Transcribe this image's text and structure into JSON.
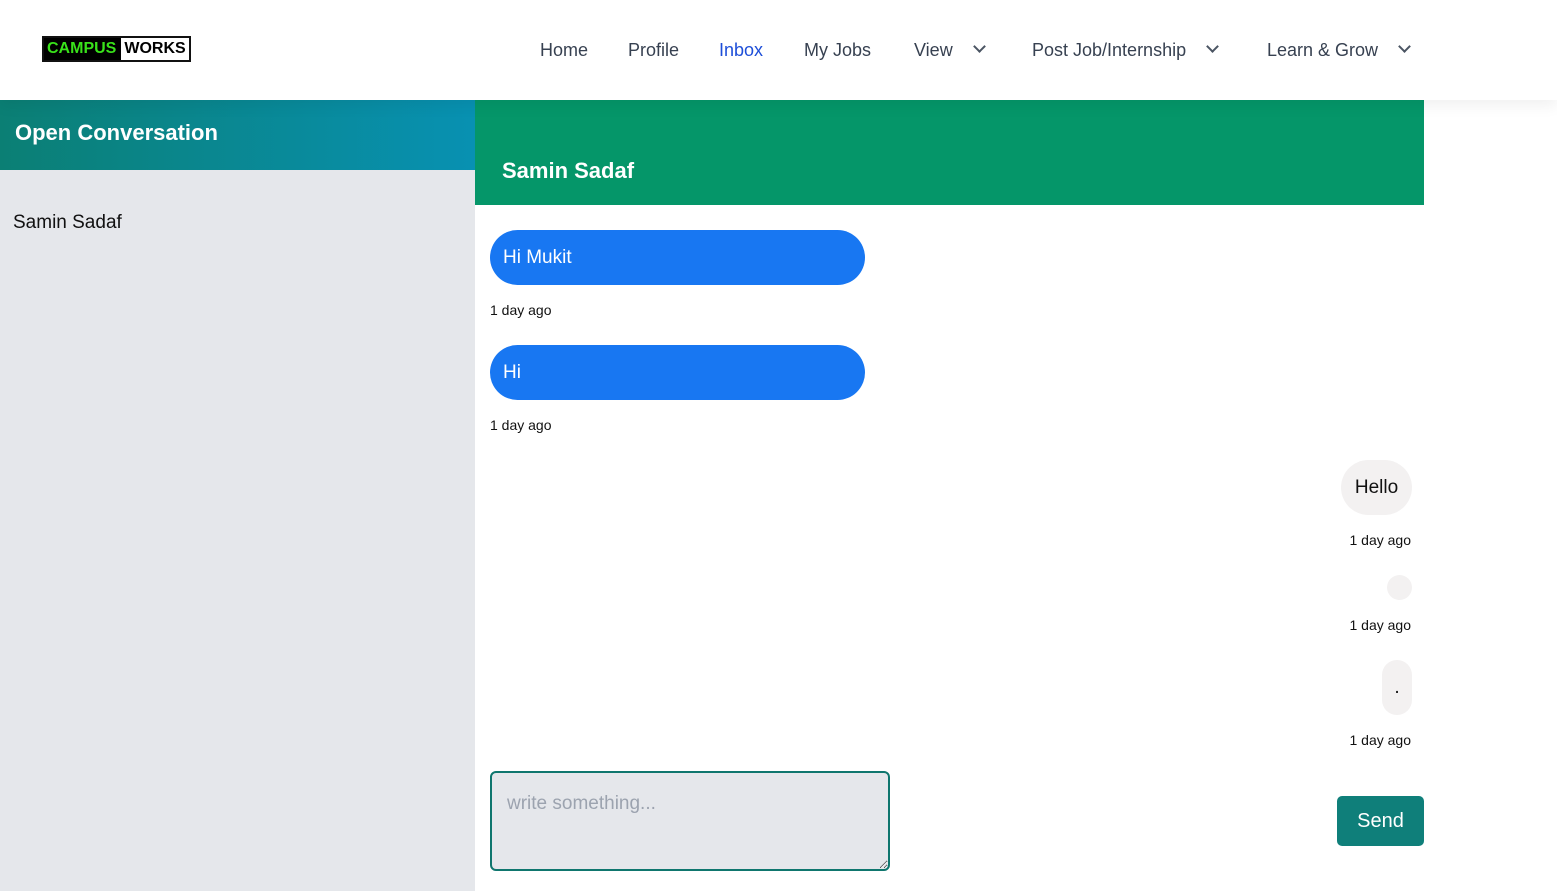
{
  "logo": {
    "part1": "CAMPUS",
    "part2": "WORKS"
  },
  "nav": {
    "home": "Home",
    "profile": "Profile",
    "inbox": "Inbox",
    "my_jobs": "My Jobs",
    "view": "View",
    "post_job": "Post Job/Internship",
    "learn": "Learn & Grow",
    "active_color": "#1d4ed8"
  },
  "sidebar": {
    "title": "Open Conversation",
    "conversations": [
      {
        "name": "Samin Sadaf"
      }
    ]
  },
  "chat": {
    "recipient": "Samin Sadaf",
    "messages": [
      {
        "direction": "incoming",
        "text": "Hi Mukit",
        "time": "1 day ago"
      },
      {
        "direction": "incoming",
        "text": "Hi",
        "time": "1 day ago"
      },
      {
        "direction": "outgoing",
        "text": "Hello",
        "time": "1 day ago"
      },
      {
        "direction": "outgoing",
        "text": "",
        "time": "1 day ago"
      },
      {
        "direction": "outgoing",
        "text": ".",
        "time": "1 day ago"
      }
    ],
    "incoming_color": "#1877f2",
    "outgoing_color": "#f3f1f1"
  },
  "composer": {
    "placeholder": "write something...",
    "value": "",
    "send_label": "Send"
  }
}
